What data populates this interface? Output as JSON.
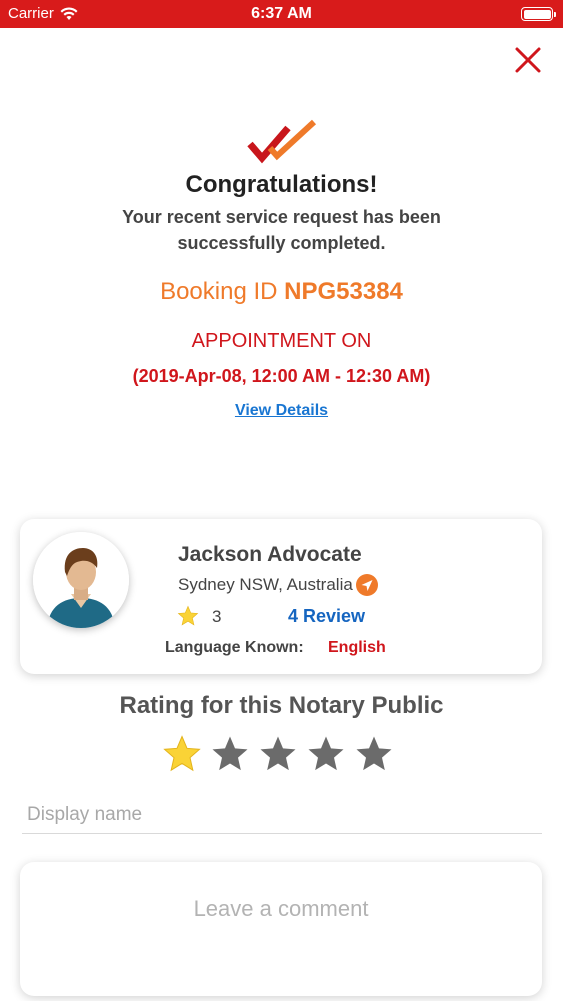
{
  "status_bar": {
    "carrier": "Carrier",
    "time": "6:37 AM"
  },
  "header": {
    "title": "Congratulations!",
    "message": "Your recent service request has been successfully completed."
  },
  "booking": {
    "label": "Booking ID",
    "id": "NPG53384"
  },
  "appointment": {
    "label": "APPOINTMENT ON",
    "time": "(2019-Apr-08, 12:00 AM - 12:30 AM)",
    "view_details": "View Details"
  },
  "profile": {
    "name": "Jackson Advocate",
    "location": "Sydney NSW, Australia",
    "rating": "3",
    "reviews": "4 Review",
    "language_label": "Language Known:",
    "language": "English"
  },
  "rating_section": {
    "title": "Rating for this Notary Public",
    "selected_stars": 1,
    "total_stars": 5
  },
  "form": {
    "display_name_placeholder": "Display name",
    "comment_placeholder": "Leave a comment"
  },
  "colors": {
    "brand_red": "#d0161c",
    "orange": "#ef7a2a",
    "link_blue": "#1565c0",
    "star_gold": "#fad336",
    "star_gray": "#6b6b6b"
  }
}
